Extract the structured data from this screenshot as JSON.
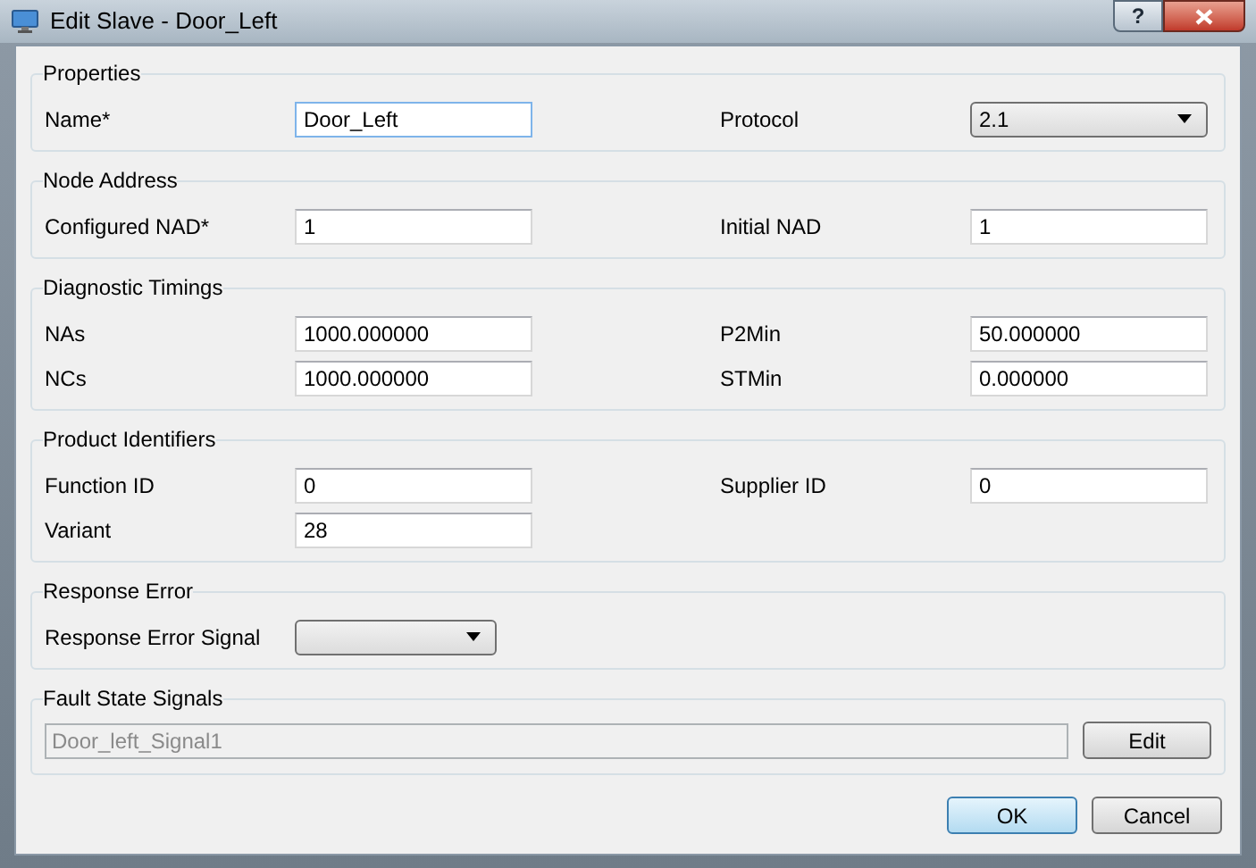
{
  "window": {
    "title": "Edit Slave - Door_Left",
    "help_label": "?"
  },
  "groups": [
    {
      "title": "Properties",
      "rows": [
        [
          {
            "label": "Name*",
            "kind": "text",
            "value": "Door_Left",
            "focused": true
          },
          {
            "label": "Protocol",
            "kind": "select",
            "value": "2.1"
          }
        ]
      ]
    },
    {
      "title": "Node Address",
      "rows": [
        [
          {
            "label": "Configured NAD*",
            "kind": "text",
            "value": "1"
          },
          {
            "label": "Initial NAD",
            "kind": "text",
            "value": "1"
          }
        ]
      ]
    },
    {
      "title": "Diagnostic Timings",
      "rows": [
        [
          {
            "label": "NAs",
            "kind": "text",
            "value": "1000.000000"
          },
          {
            "label": "P2Min",
            "kind": "text",
            "value": "50.000000"
          }
        ],
        [
          {
            "label": "NCs",
            "kind": "text",
            "value": "1000.000000"
          },
          {
            "label": "STMin",
            "kind": "text",
            "value": "0.000000"
          }
        ]
      ]
    },
    {
      "title": "Product Identifiers",
      "rows": [
        [
          {
            "label": "Function ID",
            "kind": "text",
            "value": "0"
          },
          {
            "label": "Supplier ID",
            "kind": "text",
            "value": "0"
          }
        ],
        [
          {
            "label": "Variant",
            "kind": "text",
            "value": "28"
          }
        ]
      ]
    },
    {
      "title": "Response Error",
      "rows": [
        [
          {
            "label": "Response Error Signal",
            "kind": "select",
            "short": true
          }
        ]
      ]
    }
  ],
  "fault": {
    "title": "Fault State Signals",
    "value": "Door_left_Signal1",
    "disabled": true,
    "button": "Edit"
  },
  "buttons": [
    {
      "label": "OK",
      "default": true
    },
    {
      "label": "Cancel",
      "default": false
    }
  ]
}
